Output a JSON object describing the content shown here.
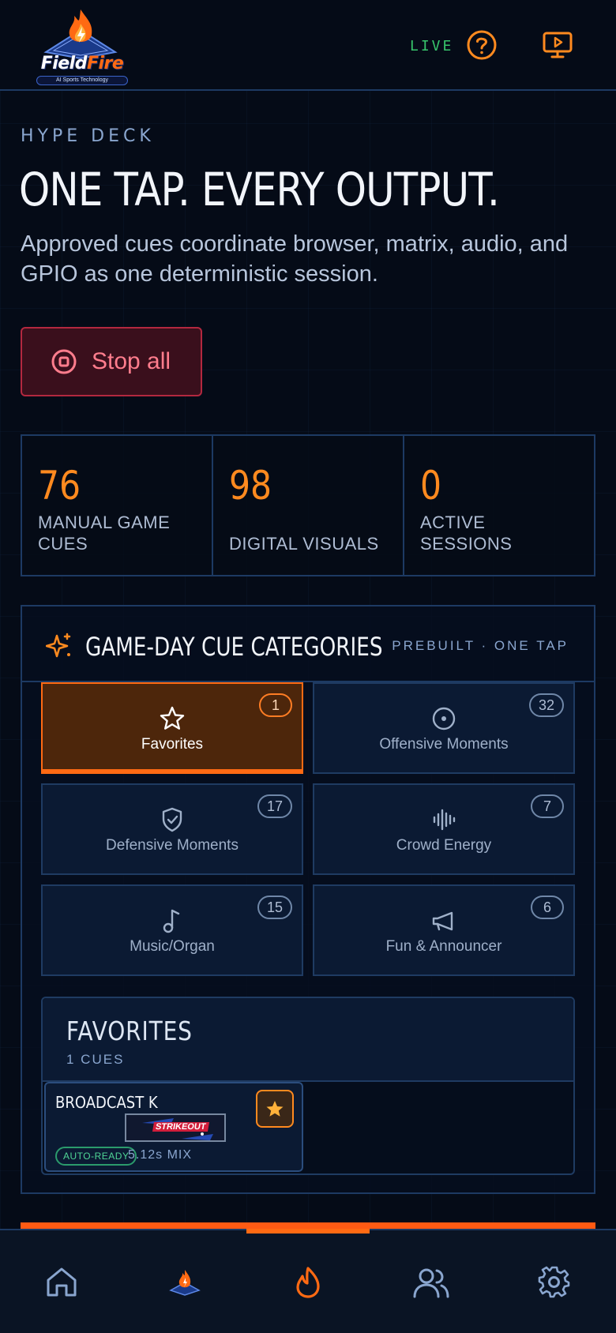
{
  "header": {
    "logo_name": "Field",
    "logo_fire": "Fire",
    "logo_subtitle": "AI Sports Technology",
    "live_label": "LIVE"
  },
  "hero": {
    "eyebrow": "HYPE DECK",
    "title": "ONE TAP. EVERY OUTPUT.",
    "description": "Approved cues coordinate browser, matrix, audio, and GPIO as one deterministic session.",
    "stop_label": "Stop all"
  },
  "stats": [
    {
      "value": "76",
      "label": "MANUAL GAME CUES"
    },
    {
      "value": "98",
      "label": "DIGITAL VISUALS"
    },
    {
      "value": "0",
      "label": "ACTIVE SESSIONS"
    }
  ],
  "categories_panel": {
    "title": "GAME-DAY CUE CATEGORIES",
    "meta": "PREBUILT · ONE TAP",
    "items": [
      {
        "label": "Favorites",
        "count": "1",
        "icon": "star-icon",
        "active": true
      },
      {
        "label": "Offensive Moments",
        "count": "32",
        "icon": "target-icon"
      },
      {
        "label": "Defensive Moments",
        "count": "17",
        "icon": "shield-check-icon"
      },
      {
        "label": "Crowd Energy",
        "count": "7",
        "icon": "audio-wave-icon"
      },
      {
        "label": "Music/Organ",
        "count": "15",
        "icon": "music-note-icon"
      },
      {
        "label": "Fun & Announcer",
        "count": "6",
        "icon": "megaphone-icon"
      }
    ]
  },
  "favorites": {
    "title": "FAVORITES",
    "count_label": "1 CUES",
    "cues": [
      {
        "title": "BROADCAST K",
        "thumb_text": "STRIKEOUT",
        "badge": "AUTO-READY",
        "duration": "5.12s MIX",
        "favorited": true
      }
    ]
  },
  "bottom_nav": {
    "items": [
      "home-icon",
      "fieldfire-logo-icon",
      "flame-icon",
      "users-icon",
      "settings-icon"
    ],
    "active_index": 2
  },
  "colors": {
    "accent": "#ff6a13",
    "live": "#37c46b",
    "danger": "#ff7d8d",
    "border": "#1d3a63"
  }
}
